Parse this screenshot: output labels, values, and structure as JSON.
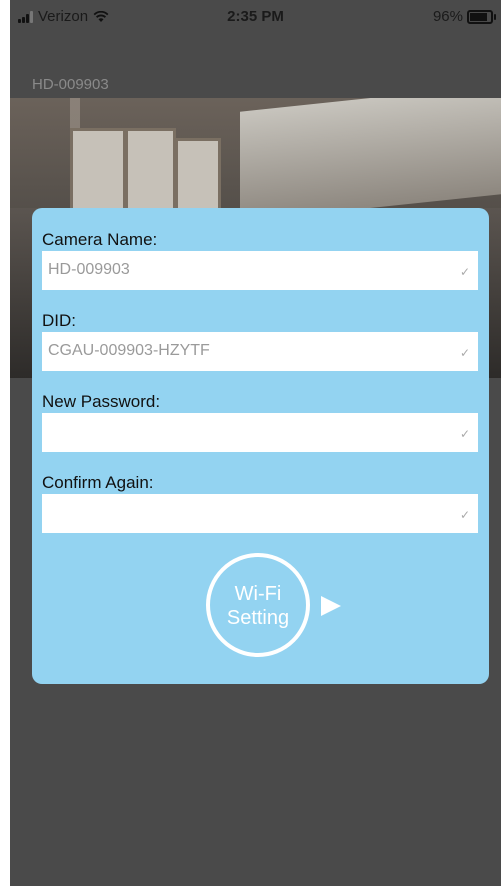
{
  "status_bar": {
    "carrier": "Verizon",
    "time": "2:35 PM",
    "battery": "96%",
    "battery_level": 0.96,
    "icons": [
      "signal-icon",
      "wifi-icon",
      "battery-icon"
    ]
  },
  "device_title": "HD-009903",
  "form": {
    "camera_name_label": "Camera Name:",
    "camera_name_value": "HD-009903",
    "did_label": "DID:",
    "did_value": "CGAU-009903-HZYTF",
    "new_password_label": "New Password:",
    "new_password_value": "",
    "confirm_label": "Confirm Again:",
    "confirm_value": ""
  },
  "wifi_button": {
    "line1": "Wi-Fi",
    "line2": "Setting"
  },
  "colors": {
    "background": "#4a4a4a",
    "modal": "#93d3f1",
    "field": "#ffffff"
  }
}
